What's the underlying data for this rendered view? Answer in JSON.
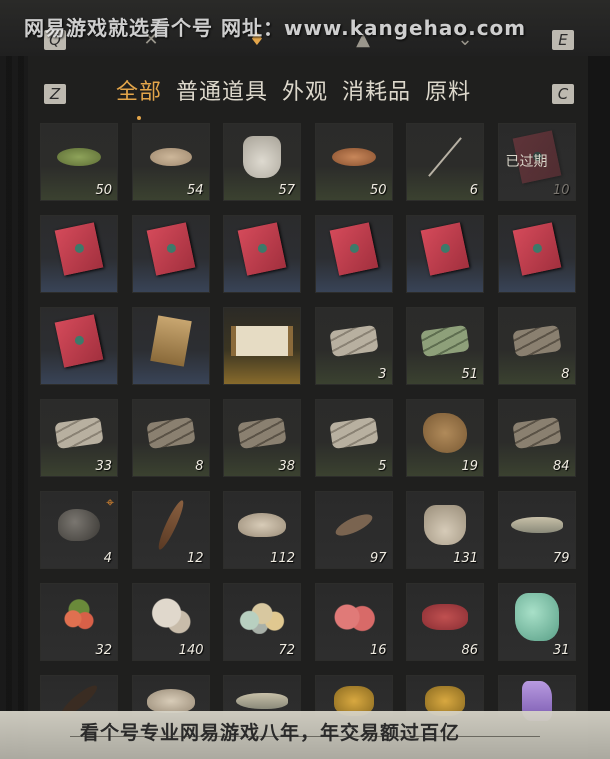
{
  "watermark": {
    "top_text": "网易游戏就选看个号  网址：www.kangehao.com",
    "bottom_text": "看个号专业网易游戏八年，年交易额过百亿"
  },
  "topbar": {
    "left_key": "Q",
    "right_key": "E"
  },
  "tabs": {
    "left_key": "Z",
    "right_key": "C",
    "items": [
      "全部",
      "普通道具",
      "外观",
      "消耗品",
      "原料"
    ],
    "active_index": 0
  },
  "inventory": {
    "items": [
      {
        "icon": "herb-powder-icon",
        "count": "50",
        "bg": "green"
      },
      {
        "icon": "worm-bait-icon",
        "count": "54",
        "bg": "green"
      },
      {
        "icon": "cloth-sack-icon",
        "count": "57",
        "bg": "green"
      },
      {
        "icon": "grain-pile-icon",
        "count": "50",
        "bg": "green"
      },
      {
        "icon": "arrows-icon",
        "count": "6",
        "bg": "green"
      },
      {
        "icon": "red-envelope-icon",
        "count": "10",
        "bg": "grey",
        "expired": "已过期"
      },
      {
        "icon": "red-envelope-icon",
        "count": "",
        "bg": "blue"
      },
      {
        "icon": "red-envelope-icon",
        "count": "",
        "bg": "blue"
      },
      {
        "icon": "red-envelope-icon",
        "count": "",
        "bg": "blue"
      },
      {
        "icon": "red-envelope-icon",
        "count": "",
        "bg": "blue"
      },
      {
        "icon": "red-envelope-icon",
        "count": "",
        "bg": "blue"
      },
      {
        "icon": "red-envelope-icon",
        "count": "",
        "bg": "blue"
      },
      {
        "icon": "red-envelope-icon",
        "count": "",
        "bg": "blue"
      },
      {
        "icon": "wooden-tablet-icon",
        "count": "",
        "bg": "blue"
      },
      {
        "icon": "painting-scroll-icon",
        "count": "",
        "bg": "gold"
      },
      {
        "icon": "birch-logs-icon",
        "count": "3",
        "bg": "green"
      },
      {
        "icon": "bamboo-logs-icon",
        "count": "51",
        "bg": "green"
      },
      {
        "icon": "dark-logs-icon",
        "count": "8",
        "bg": "green"
      },
      {
        "icon": "pine-logs-icon",
        "count": "33",
        "bg": "green"
      },
      {
        "icon": "oak-logs-icon",
        "count": "8",
        "bg": "green"
      },
      {
        "icon": "branch-logs-icon",
        "count": "38",
        "bg": "green"
      },
      {
        "icon": "pale-logs-icon",
        "count": "5",
        "bg": "green"
      },
      {
        "icon": "fur-pelt-icon",
        "count": "19",
        "bg": "green"
      },
      {
        "icon": "firewood-icon",
        "count": "84",
        "bg": "green"
      },
      {
        "icon": "ore-rock-icon",
        "count": "4",
        "bg": "grey",
        "target": true
      },
      {
        "icon": "feather-icon",
        "count": "12",
        "bg": "grey"
      },
      {
        "icon": "oyster-shell-icon",
        "count": "112",
        "bg": "grey"
      },
      {
        "icon": "shrimp-icon",
        "count": "97",
        "bg": "grey"
      },
      {
        "icon": "grain-bag-icon",
        "count": "131",
        "bg": "grey"
      },
      {
        "icon": "fish-icon",
        "count": "79",
        "bg": "grey"
      },
      {
        "icon": "berries-icon",
        "count": "32",
        "bg": "grey"
      },
      {
        "icon": "mushroom-icon",
        "count": "140",
        "bg": "grey"
      },
      {
        "icon": "eggs-icon",
        "count": "72",
        "bg": "grey"
      },
      {
        "icon": "meat-chunks-icon",
        "count": "16",
        "bg": "grey"
      },
      {
        "icon": "steak-icon",
        "count": "86",
        "bg": "grey"
      },
      {
        "icon": "jade-stone-icon",
        "count": "31",
        "bg": "grey"
      },
      {
        "icon": "dark-feather-icon",
        "count": "",
        "bg": "grey"
      },
      {
        "icon": "conch-shell-icon",
        "count": "",
        "bg": "grey"
      },
      {
        "icon": "blue-fish-icon",
        "count": "",
        "bg": "grey"
      },
      {
        "icon": "golden-fish-icon",
        "count": "",
        "bg": "grey"
      },
      {
        "icon": "gold-ore-icon",
        "count": "",
        "bg": "grey"
      },
      {
        "icon": "amethyst-icon",
        "count": "",
        "bg": "grey"
      }
    ]
  }
}
